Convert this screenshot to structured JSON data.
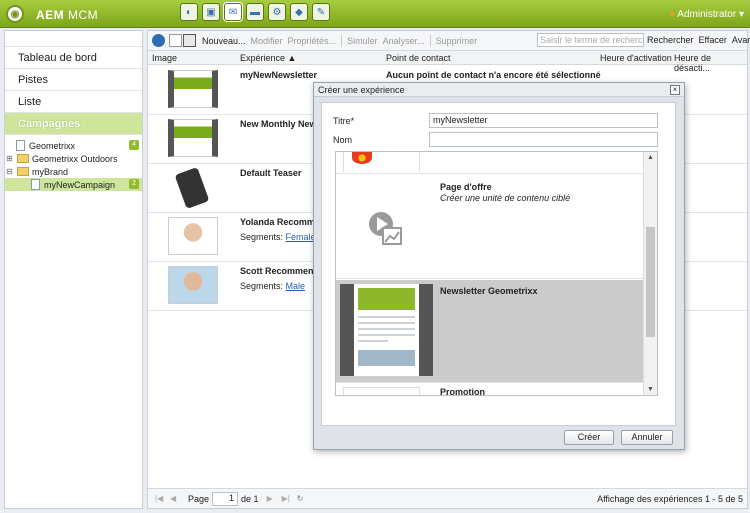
{
  "app": {
    "logo": "adobe-aem-logo",
    "title_bold": "AEM",
    "title_rest": " MCM",
    "user": "Administrator"
  },
  "apps": [
    {
      "name": "websites-icon"
    },
    {
      "name": "digital-assets-icon"
    },
    {
      "name": "campaigns-icon"
    },
    {
      "name": "community-icon"
    },
    {
      "name": "tools-icon"
    },
    {
      "name": "tagging-icon"
    },
    {
      "name": "inbox-icon"
    }
  ],
  "sidebar": {
    "items": [
      {
        "label": "Tableau de bord"
      },
      {
        "label": "Pistes"
      },
      {
        "label": "Liste"
      },
      {
        "label": "Campagnes"
      }
    ],
    "tree": [
      {
        "label": "Geometrixx",
        "count": "4"
      },
      {
        "label": "Geometrixx Outdoors"
      },
      {
        "label": "myBrand"
      },
      {
        "label": "myNewCampaign",
        "count": "2"
      }
    ]
  },
  "toolbar": {
    "new": "Nouveau...",
    "edit": "Modifier",
    "props": "Propriétés...",
    "simulate": "Simuler",
    "analyse": "Analyser...",
    "delete": "Supprimer",
    "search_placeholder": "Saisir le terme de recherche",
    "search": "Rechercher",
    "clear": "Effacer",
    "advanced": "Avancé"
  },
  "table": {
    "headers": [
      "Image",
      "Expérience ▲",
      "Point de contact",
      "Heure d'activation",
      "Heure de désacti..."
    ],
    "rows": [
      {
        "name": "myNewNewsletter",
        "contact": "Aucun point de contact n'a encore été sélectionné"
      },
      {
        "name": "New Monthly News"
      },
      {
        "name": "Default Teaser"
      },
      {
        "name": "Yolanda Recomme",
        "seg_label": "Segments:",
        "seg": "Female"
      },
      {
        "name": "Scott Recommends",
        "seg_label": "Segments:",
        "seg": "Male"
      }
    ]
  },
  "pager": {
    "page_label": "Page",
    "page": "1",
    "of": "de 1",
    "status": "Affichage des expériences 1 - 5 de 5"
  },
  "dialog": {
    "title": "Créer une expérience",
    "title_label": "Titre*",
    "title_value": "myNewsletter",
    "name_label": "Nom",
    "name_value": "",
    "templates": [
      {
        "name": "Page d'offre",
        "desc": "Créer une unité de contenu ciblé"
      },
      {
        "name": "Newsletter Geometrixx",
        "desc": ""
      },
      {
        "name": "Promotion",
        "desc": ""
      }
    ],
    "create": "Créer",
    "cancel": "Annuler"
  }
}
